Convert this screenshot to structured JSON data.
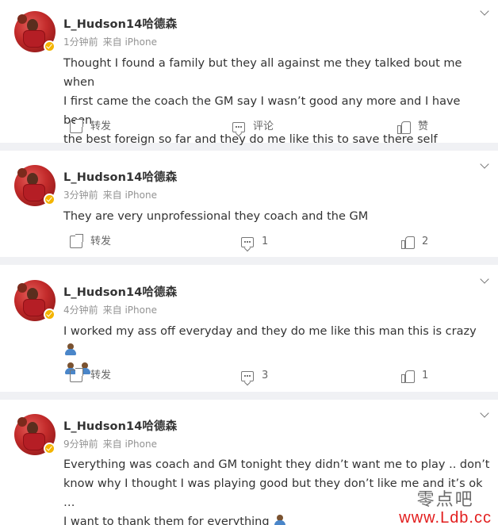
{
  "posts": [
    {
      "username": "L_Hudson14哈德森",
      "time": "1分钟前",
      "source": "来自 iPhone",
      "text_lines": [
        "Thought I found a family but they all against me they talked bout me when",
        "I first came the coach the GM say I wasn’t good any more and I have been",
        "the best foreign so far and they do me like this to save there self"
      ],
      "share": "转发",
      "comment": "评论",
      "like": "赞"
    },
    {
      "username": "L_Hudson14哈德森",
      "time": "3分钟前",
      "source": "来自 iPhone",
      "text_lines": [
        "They are very unprofessional they coach and the GM"
      ],
      "share": "转发",
      "comment": "1",
      "like": "2"
    },
    {
      "username": "L_Hudson14哈德森",
      "time": "4分钟前",
      "source": "来自 iPhone",
      "text_lines": [
        "I worked my ass off everyday and they do me like this man this is crazy"
      ],
      "share": "转发",
      "comment": "3",
      "like": "1"
    },
    {
      "username": "L_Hudson14哈德森",
      "time": "9分钟前",
      "source": "来自 iPhone",
      "text_lines": [
        "Everything was coach and GM tonight they didn’t want me to play .. don’t",
        "know why I thought I was playing good but they don’t like me and it’s ok …",
        "I want to thank them for everything"
      ]
    }
  ],
  "watermark": {
    "cn": "零点吧",
    "url": "www.Ldb.cc"
  }
}
